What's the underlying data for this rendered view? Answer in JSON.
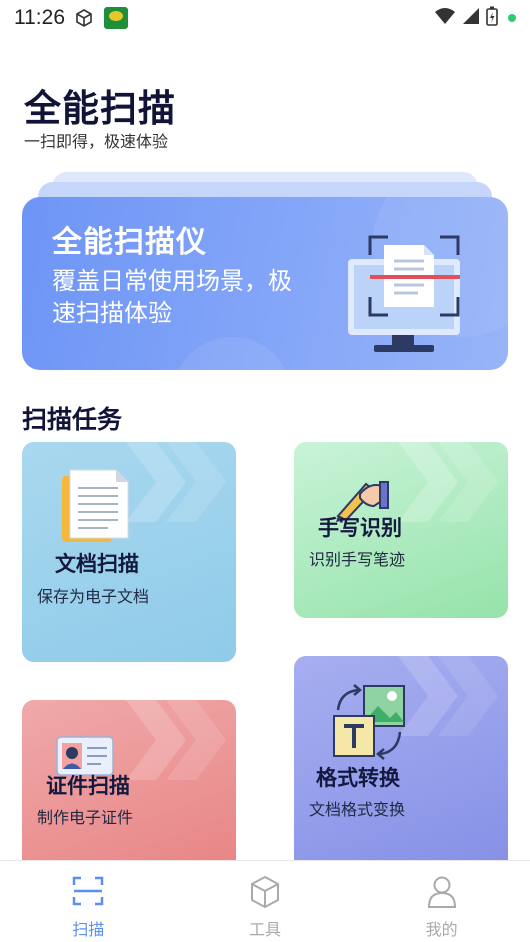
{
  "status_bar": {
    "time": "11:26"
  },
  "header": {
    "title": "全能扫描",
    "subtitle": "一扫即得，极速体验"
  },
  "banner": {
    "title": "全能扫描仪",
    "description": "覆盖日常使用场景，极速扫描体验",
    "icon": "monitor-scan-icon"
  },
  "section": {
    "title": "扫描任务"
  },
  "tasks": [
    {
      "title": "文档扫描",
      "subtitle": "保存为电子文档",
      "icon": "document-icon"
    },
    {
      "title": "手写识别",
      "subtitle": "识别手写笔迹",
      "icon": "handwriting-icon"
    },
    {
      "title": "证件扫描",
      "subtitle": "制作电子证件",
      "icon": "id-card-icon"
    },
    {
      "title": "格式转换",
      "subtitle": "文档格式变换",
      "icon": "format-convert-icon"
    }
  ],
  "nav": [
    {
      "label": "扫描",
      "icon": "scan-icon",
      "active": true
    },
    {
      "label": "工具",
      "icon": "cube-icon",
      "active": false
    },
    {
      "label": "我的",
      "icon": "user-icon",
      "active": false
    }
  ],
  "colors": {
    "accent": "#5d8ef2",
    "title": "#111437",
    "nav_inactive": "#aaaaaa"
  }
}
